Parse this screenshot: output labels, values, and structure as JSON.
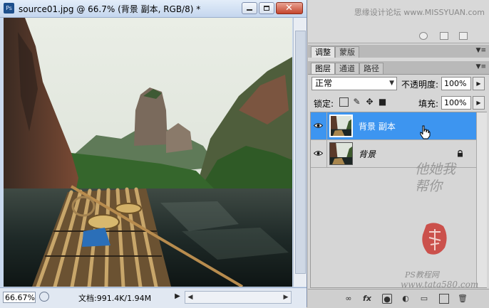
{
  "colors": {
    "selection_blue": "#3d95f0",
    "titlebar": "#c4d6ee",
    "panel_bg": "#d6d6d6",
    "close_red": "#c4452d"
  },
  "document": {
    "app_icon_text": "Ps",
    "title": "source01.jpg @ 66.7% (背景 副本, RGB/8) *",
    "zoom": "66.67%",
    "doc_info": "文档:991.4K/1.94M"
  },
  "top_panel": {
    "watermark": "思缘设计论坛 www.MISSYUAN.com"
  },
  "adjust_tabs": [
    "调整",
    "蒙版"
  ],
  "layers_tabs": [
    "图层",
    "通道",
    "路径"
  ],
  "layers_panel": {
    "blend_mode": "正常",
    "opacity_label": "不透明度:",
    "opacity": "100%",
    "lock_label": "锁定:",
    "fill_label": "填充:",
    "fill": "100%",
    "layers": [
      {
        "name": "背景 副本",
        "visible": true,
        "selected": true,
        "locked": false
      },
      {
        "name": "背景",
        "visible": true,
        "selected": false,
        "locked": true
      }
    ]
  },
  "watermarks": {
    "side": "他她我帮你",
    "bottom_line1": "PS教程网",
    "bottom_line2": "www.tata580.com"
  },
  "icons": [
    "ps-logo-icon",
    "minimize-icon",
    "maximize-icon",
    "close-icon",
    "eye-icon",
    "lock-icon",
    "link-icon",
    "fx-icon",
    "mask-icon",
    "adjustment-icon",
    "folder-icon",
    "new-layer-icon",
    "trash-icon",
    "panel-menu-icon"
  ]
}
